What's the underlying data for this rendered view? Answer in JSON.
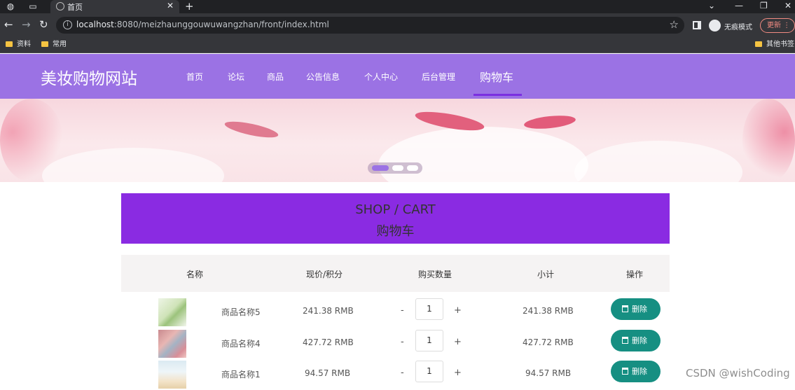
{
  "browser": {
    "tab_title": "首页",
    "url_host": "localhost",
    "url_rest": ":8080/meizhaunggouwuwangzhan/front/index.html",
    "incognito_label": "无痕模式",
    "update_label": "更新",
    "bookmarks": [
      "资料",
      "常用"
    ],
    "other_bookmarks": "其他书签"
  },
  "site": {
    "brand": "美妆购物网站",
    "nav": [
      {
        "label": "首页"
      },
      {
        "label": "论坛"
      },
      {
        "label": "商品"
      },
      {
        "label": "公告信息"
      },
      {
        "label": "个人中心"
      },
      {
        "label": "后台管理"
      },
      {
        "label": "购物车",
        "active": true
      }
    ],
    "accent_color": "#9b72e4"
  },
  "carousel": {
    "dots": 3,
    "active_index": 0
  },
  "cart": {
    "title_en": "SHOP / CART",
    "title_zh": "购物车",
    "title_bg": "#8a2be2",
    "headers": {
      "name": "名称",
      "price": "现价/积分",
      "quantity": "购买数量",
      "subtotal": "小计",
      "action": "操作"
    },
    "minus": "-",
    "plus": "+",
    "delete_label": "删除",
    "delete_color": "#168f82",
    "rows": [
      {
        "name": "商品名称5",
        "price": "241.38 RMB",
        "quantity": "1",
        "subtotal": "241.38 RMB"
      },
      {
        "name": "商品名称4",
        "price": "427.72 RMB",
        "quantity": "1",
        "subtotal": "427.72 RMB"
      },
      {
        "name": "商品名称1",
        "price": "94.57 RMB",
        "quantity": "1",
        "subtotal": "94.57 RMB"
      }
    ]
  },
  "watermark": "CSDN @wishCoding"
}
